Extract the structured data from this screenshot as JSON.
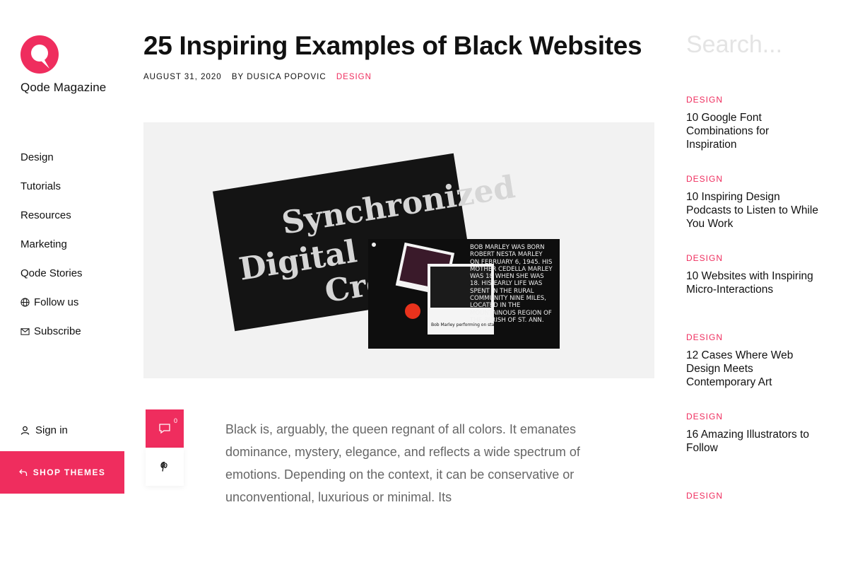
{
  "brand": {
    "name": "Qode Magazine",
    "accent_color": "#ef2d5e"
  },
  "nav": [
    {
      "label": "Design"
    },
    {
      "label": "Tutorials"
    },
    {
      "label": "Resources"
    },
    {
      "label": "Marketing"
    },
    {
      "label": "Qode Stories"
    },
    {
      "label": "Follow us",
      "icon": "globe-icon"
    },
    {
      "label": "Subscribe",
      "icon": "envelope-icon"
    }
  ],
  "account": {
    "signin_label": "Sign in",
    "icon": "user-icon"
  },
  "shop": {
    "label": "SHOP THEMES",
    "icon": "return-arrow-icon"
  },
  "article": {
    "title": "25 Inspiring Examples of Black Websites",
    "date": "AUGUST 31, 2020",
    "author": "BY DUSICA POPOVIC",
    "category": "DESIGN",
    "body": "Black is, arguably, the queen regnant of all colors. It emanates dominance, mystery, elegance, and reflects a wide spectrum of emotions. Depending on the context, it can be conservative or unconventional, luxurious or minimal. Its"
  },
  "hero": {
    "screen1_text": [
      "Synchronized",
      "Digital",
      "Crea"
    ],
    "screen2_text": "BOB MARLEY WAS BORN ROBERT NESTA MARLEY ON FEBRUARY 6, 1945. HIS MOTHER CEDELLA MARLEY WAS 18 WHEN SHE WAS 18. HIS EARLY LIFE WAS SPENT IN THE RURAL COMMUNITY NINE MILES, LOCATED IN THE MOUNTAINOUS REGION OF THE PARISH OF ST. ANN.",
    "photo_caption": "Bob Marley performing on stage with the I Threes"
  },
  "share": {
    "comment_count": "0",
    "comment_icon": "comment-icon",
    "pinterest_icon": "pinterest-icon"
  },
  "search": {
    "placeholder": "Search..."
  },
  "sidebar_posts": [
    {
      "category": "DESIGN",
      "title": "10 Google Font Combinations for Inspiration"
    },
    {
      "category": "DESIGN",
      "title": "10 Inspiring Design Podcasts to Listen to While You Work"
    },
    {
      "category": "DESIGN",
      "title": "10 Websites with Inspiring Micro-Interactions"
    },
    {
      "category": "DESIGN",
      "title": "12 Cases Where Web Design Meets Contemporary Art"
    },
    {
      "category": "DESIGN",
      "title": "16 Amazing Illustrators to Follow"
    },
    {
      "category": "DESIGN",
      "title": ""
    }
  ]
}
